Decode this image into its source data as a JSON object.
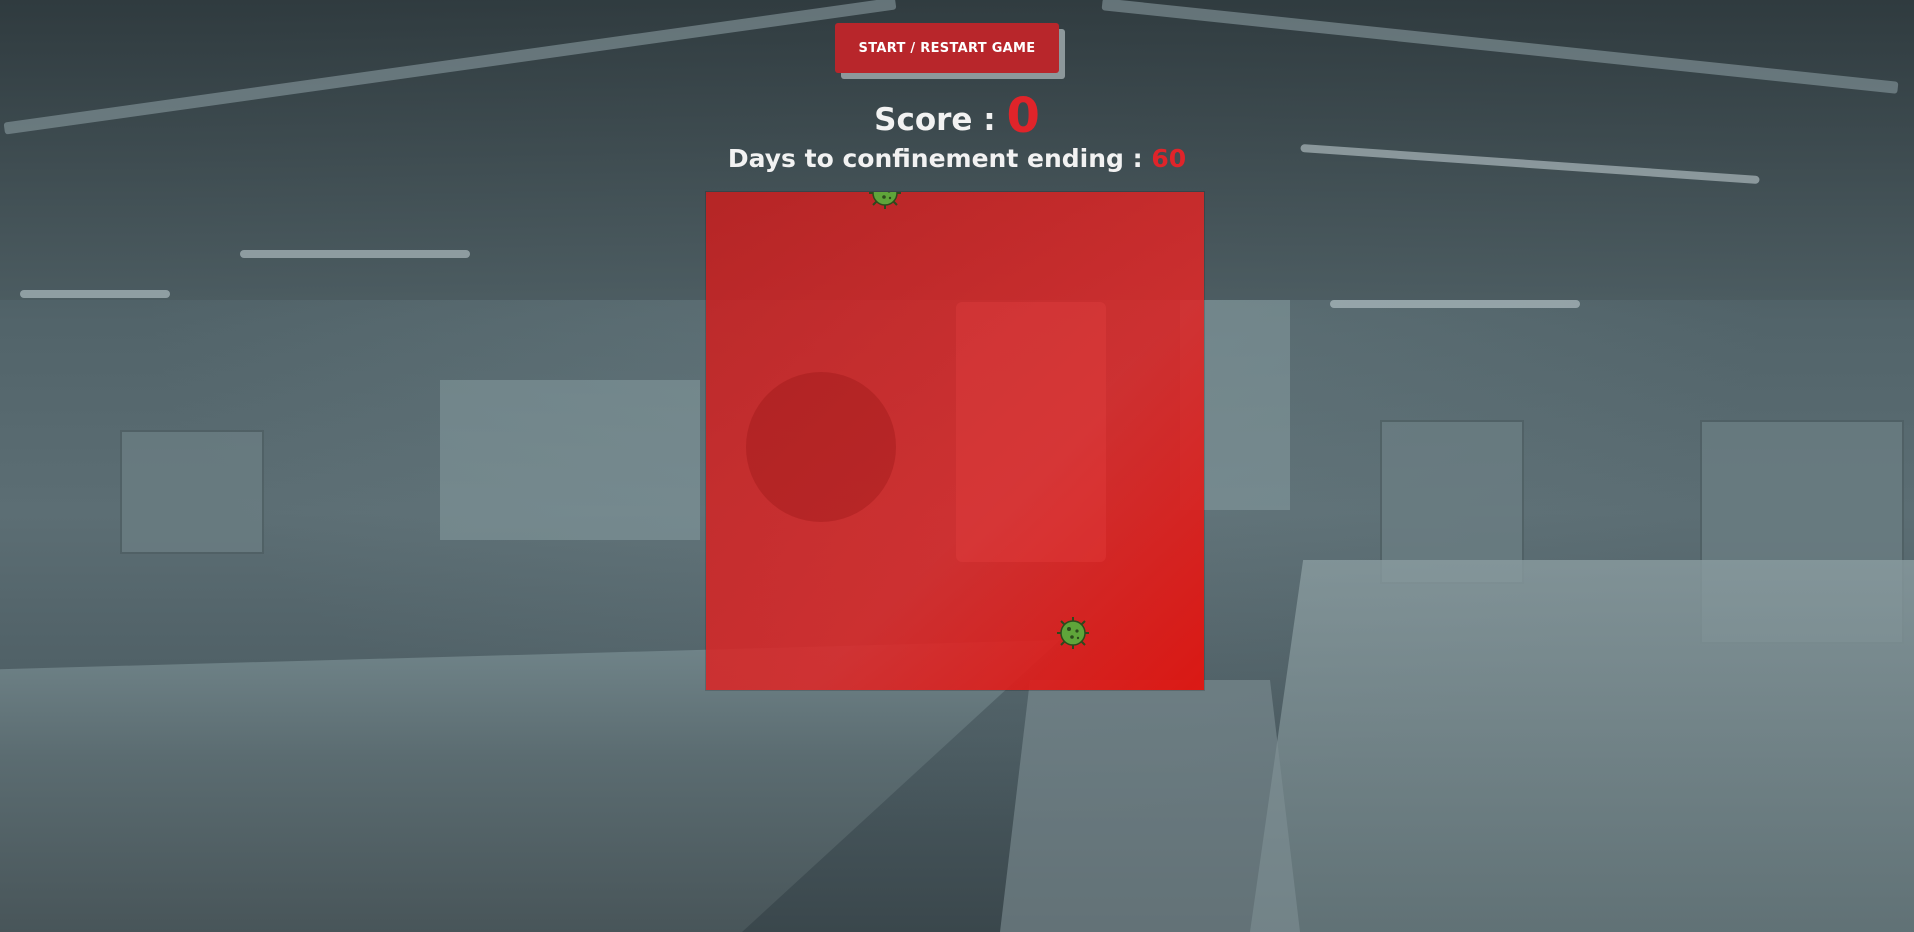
{
  "game": {
    "start_button_label": "START / RESTART GAME",
    "score_label": "Score : ",
    "score_value": "0",
    "days_label": "Days to confinement ending : ",
    "days_value": "60"
  },
  "colors": {
    "accent_red": "#e0242a",
    "button_red": "#b8262b",
    "board_red": "#d42a2a",
    "virus_green": "#5fa53a"
  },
  "board": {
    "viruses": [
      {
        "name": "virus-top",
        "icon": "virus-icon"
      },
      {
        "name": "virus-bottom",
        "icon": "virus-icon"
      }
    ]
  }
}
